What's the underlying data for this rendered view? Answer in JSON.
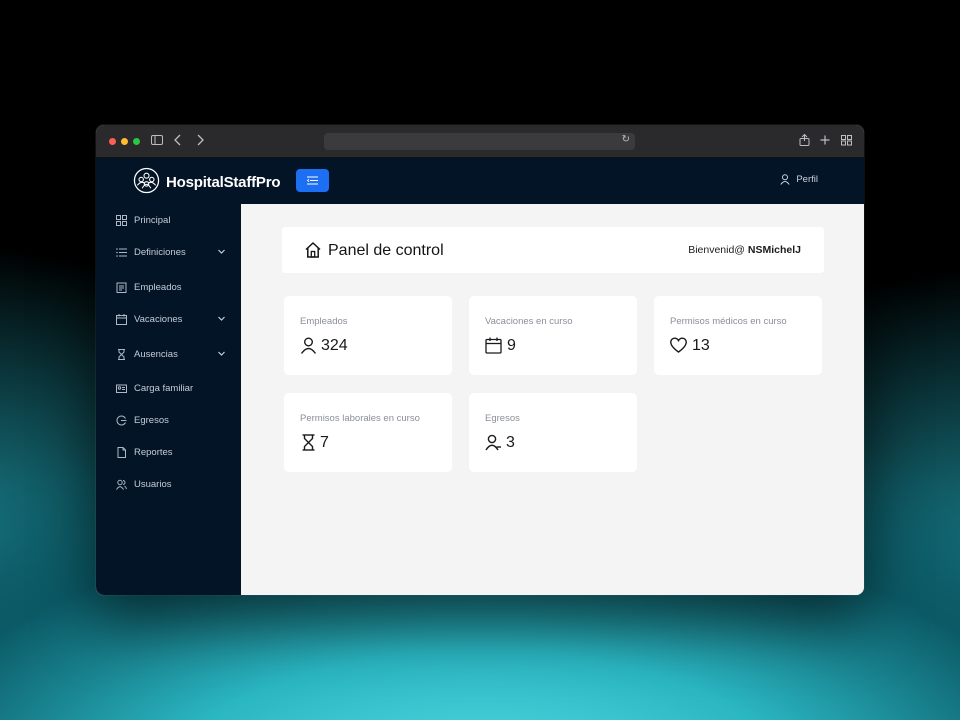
{
  "app": {
    "brand": "HospitalStaffPro",
    "profile_label": "Perfil"
  },
  "sidebar": {
    "items": [
      {
        "label": "Principal",
        "icon": "grid-icon",
        "has_submenu": false
      },
      {
        "label": "Definiciones",
        "icon": "list-icon",
        "has_submenu": true
      },
      {
        "label": "Empleados",
        "icon": "clipboard-icon",
        "has_submenu": false
      },
      {
        "label": "Vacaciones",
        "icon": "calendar-icon",
        "has_submenu": true
      },
      {
        "label": "Ausencias",
        "icon": "hourglass-icon",
        "has_submenu": true
      },
      {
        "label": "Carga familiar",
        "icon": "id-card-icon",
        "has_submenu": false
      },
      {
        "label": "Egresos",
        "icon": "exit-icon",
        "has_submenu": false
      },
      {
        "label": "Reportes",
        "icon": "file-icon",
        "has_submenu": false
      },
      {
        "label": "Usuarios",
        "icon": "users-icon",
        "has_submenu": false
      }
    ]
  },
  "dashboard": {
    "title": "Panel de control",
    "welcome_prefix": "Bienvenid@",
    "username": "NSMichelJ"
  },
  "stats": [
    {
      "label": "Empleados",
      "value": "324",
      "icon": "user-icon"
    },
    {
      "label": "Vacaciones en curso",
      "value": "9",
      "icon": "calendar-icon"
    },
    {
      "label": "Permisos médicos en curso",
      "value": "13",
      "icon": "heart-icon"
    },
    {
      "label": "Permisos laborales en curso",
      "value": "7",
      "icon": "hourglass-icon"
    },
    {
      "label": "Egresos",
      "value": "3",
      "icon": "user-minus-icon"
    }
  ],
  "colors": {
    "navy": "#041427",
    "accent": "#1c6ef2",
    "content_bg": "#f4f4f4"
  }
}
